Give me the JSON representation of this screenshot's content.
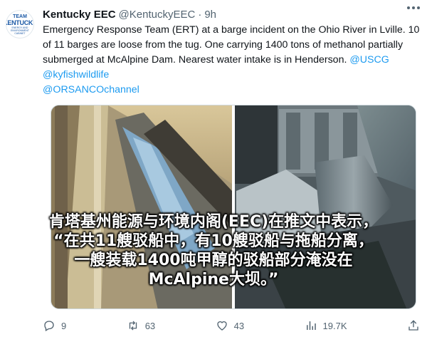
{
  "account": {
    "name": "Kentucky EEC",
    "handle": "@KentuckyEEC",
    "separator": "·",
    "time": "9h",
    "avatar": {
      "line1": "TEAM",
      "line2": "KENTUCKY",
      "line3": "ENERGY AND ENVIRONMENT CABINET"
    }
  },
  "tweet": {
    "text_parts": [
      "Emergency Response Team (ERT) at a barge incident on the Ohio River in Lville. 10 of 11 barges are loose from the tug. One carrying 1400 tons of methanol partially submerged at McAlpine Dam. Nearest water intake is in Henderson. "
    ],
    "mentions": [
      "@USCG",
      "@kyfishwildlife",
      "@ORSANCOchannel"
    ]
  },
  "caption": {
    "lines": [
      "肯塔基州能源与环境内阁(EEC)在推文中表示，",
      "“在共11艘驳船中，有10艘驳船与拖船分离，",
      "一艘装载1400吨甲醇的驳船部分淹没在",
      "McAlpine大坝。”"
    ]
  },
  "actions": {
    "replies": "9",
    "retweets": "63",
    "likes": "43",
    "views": "19.7K"
  },
  "colors": {
    "link": "#1d9bf0",
    "text": "#0f1419",
    "muted": "#536471"
  },
  "icons": [
    "more-icon",
    "reply-icon",
    "retweet-icon",
    "like-icon",
    "views-icon",
    "share-icon"
  ]
}
